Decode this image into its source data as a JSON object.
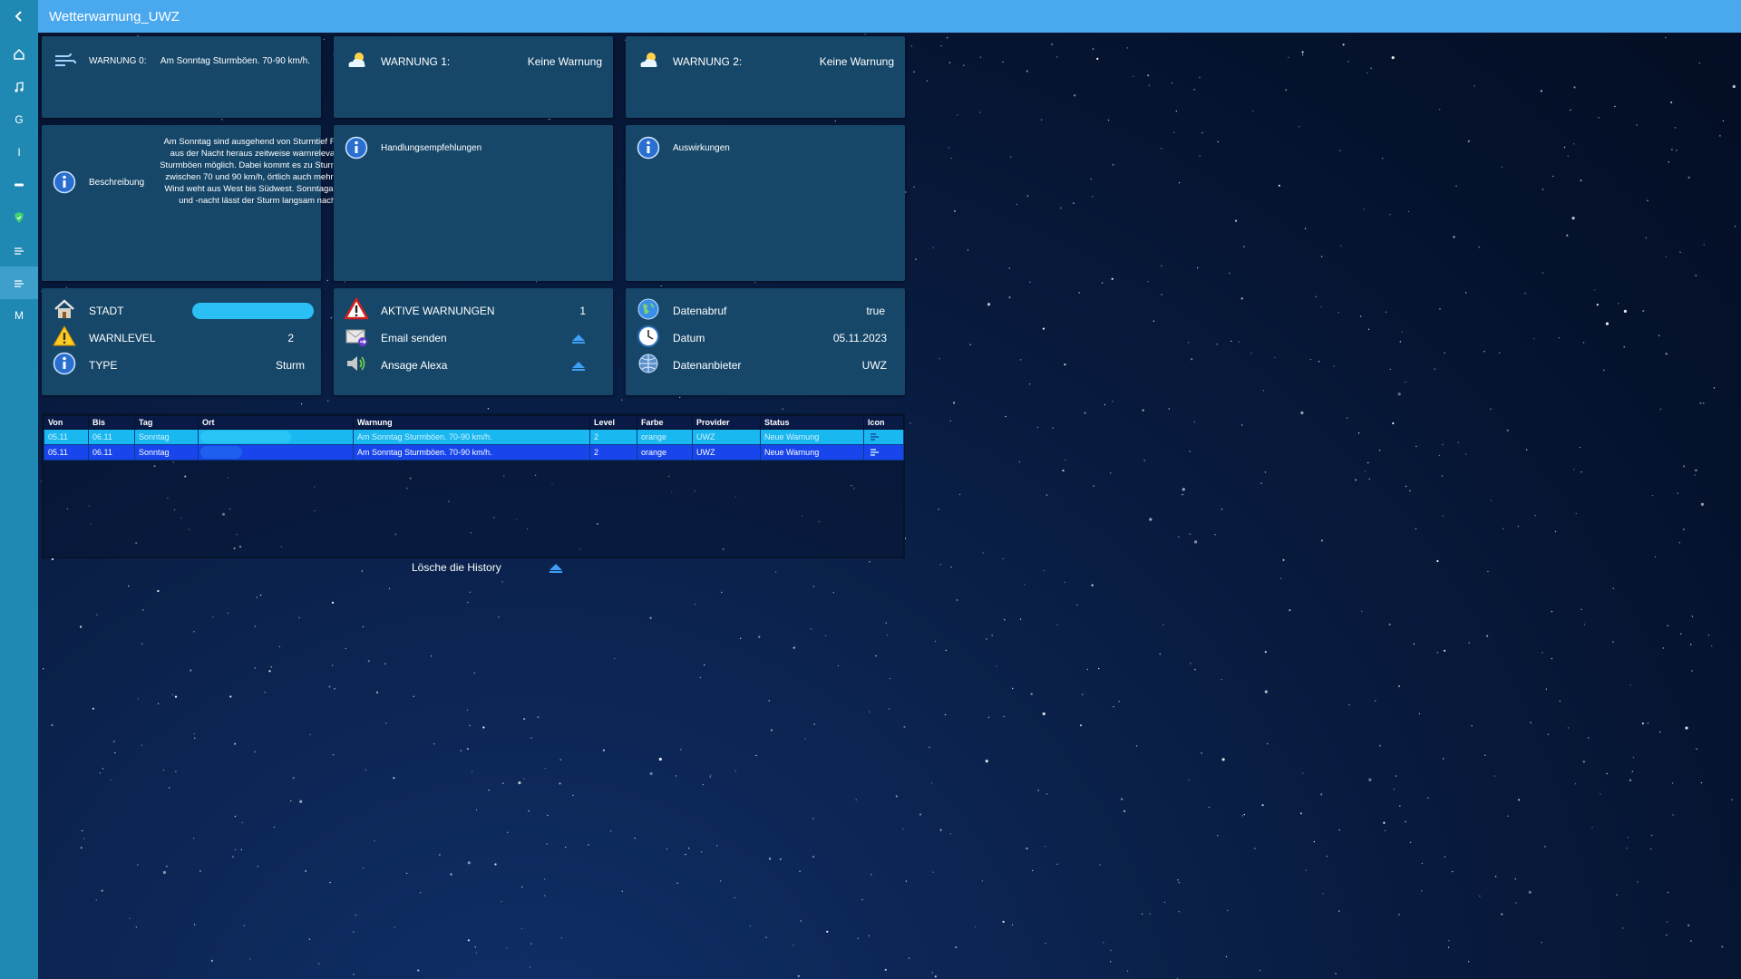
{
  "app": {
    "title": "Wetterwarnung_UWZ"
  },
  "sidebar": {
    "items": [
      {
        "label": "",
        "icon": "home-icon"
      },
      {
        "label": "",
        "icon": "music-icon"
      },
      {
        "label": "G",
        "icon": ""
      },
      {
        "label": "I",
        "icon": ""
      },
      {
        "label": "",
        "icon": "minus-icon"
      },
      {
        "label": "",
        "icon": "shield-icon"
      },
      {
        "label": "",
        "icon": "wind-icon"
      },
      {
        "label": "",
        "icon": "wind-icon"
      },
      {
        "label": "M",
        "icon": ""
      }
    ],
    "active_index": 7
  },
  "warnings": {
    "w0": {
      "label": "WARNUNG 0:",
      "value": "Am Sonntag Sturmböen. 70-90 km/h."
    },
    "w1": {
      "label": "WARNUNG 1:",
      "value": "Keine Warnung"
    },
    "w2": {
      "label": "WARNUNG 2:",
      "value": "Keine Warnung"
    }
  },
  "details": {
    "beschreibung": {
      "label": "Beschreibung",
      "text": "Am Sonntag sind ausgehend von Sturmtief FRED aus der Nacht heraus zeitweise warnrelevante Sturmböen möglich. Dabei kommt es zu Sturmböen zwischen 70 und 90 km/h, örtlich auch mehr. Der Wind weht aus West bis Südwest. Sonntagabend und -nacht lässt der Sturm langsam nach."
    },
    "handlung": {
      "label": "Handlungsempfehlungen"
    },
    "auswirkungen": {
      "label": "Auswirkungen"
    }
  },
  "info": {
    "stadt": {
      "label": "STADT"
    },
    "warnlevel": {
      "label": "WARNLEVEL",
      "value": "2"
    },
    "type": {
      "label": "TYPE",
      "value": "Sturm"
    }
  },
  "actions": {
    "aktive": {
      "label": "AKTIVE WARNUNGEN",
      "value": "1"
    },
    "email": {
      "label": "Email senden"
    },
    "alexa": {
      "label": "Ansage Alexa"
    }
  },
  "data_info": {
    "abruf": {
      "label": "Datenabruf",
      "value": "true"
    },
    "datum": {
      "label": "Datum",
      "value": "05.11.2023"
    },
    "anbieter": {
      "label": "Datenanbieter",
      "value": "UWZ"
    }
  },
  "history": {
    "columns": [
      "Von",
      "Bis",
      "Tag",
      "Ort",
      "Warnung",
      "Level",
      "Farbe",
      "Provider",
      "Status",
      "Icon"
    ],
    "rows": [
      [
        "05.11",
        "06.11",
        "Sonntag",
        "",
        "Am Sonntag Sturmböen. 70-90 km/h.",
        "2",
        "orange",
        "UWZ",
        "Neue Warnung",
        ""
      ],
      [
        "05.11",
        "06.11",
        "Sonntag",
        "",
        "Am Sonntag Sturmböen. 70-90 km/h.",
        "2",
        "orange",
        "UWZ",
        "Neue Warnung",
        ""
      ]
    ],
    "clear_label": "Lösche die History"
  },
  "colors": {
    "topbar": "#4aa8ee",
    "sidebar": "#1f88b3",
    "card": "#164769",
    "row_light": "#19b8f0",
    "row_dark": "#1846ec"
  }
}
